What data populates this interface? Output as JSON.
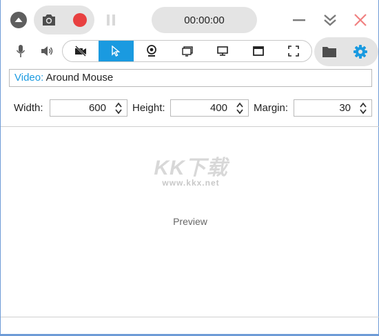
{
  "toolbar": {
    "timer": "00:00:00"
  },
  "modes": [
    {
      "name": "no-video-icon"
    },
    {
      "name": "cursor-icon",
      "active": true
    },
    {
      "name": "webcam-icon"
    },
    {
      "name": "screen-icon"
    },
    {
      "name": "monitor-icon"
    },
    {
      "name": "window-icon"
    },
    {
      "name": "fullscreen-icon"
    }
  ],
  "video_source": {
    "label": "Video:",
    "value": "Around Mouse"
  },
  "dimensions": {
    "width_label": "Width:",
    "width_value": "600",
    "height_label": "Height:",
    "height_value": "400",
    "margin_label": "Margin:",
    "margin_value": "30"
  },
  "preview": {
    "label": "Preview",
    "watermark_logo": "KK下载",
    "watermark_url": "www.kkx.net"
  },
  "colors": {
    "accent": "#1a9ae0",
    "record": "#e84040",
    "close": "#f08080"
  }
}
